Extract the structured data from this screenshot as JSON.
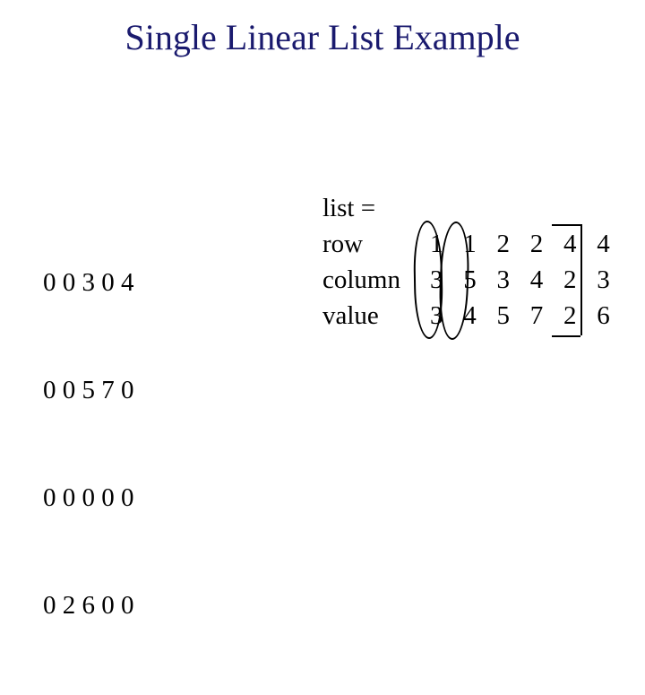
{
  "title": "Single Linear List Example",
  "matrix": {
    "rows": [
      "0 0 3 0 4",
      "0 0 5 7 0",
      "0 0 0 0 0",
      "0 2 6 0 0"
    ]
  },
  "list": {
    "header": "list =",
    "row_label": "row",
    "column_label": "column",
    "value_label": "value",
    "row": [
      "1",
      "1",
      "2",
      "2",
      "4",
      "4"
    ],
    "column": [
      "3",
      "5",
      "3",
      "4",
      "2",
      "3"
    ],
    "value": [
      "3",
      "4",
      "5",
      "7",
      "2",
      "6"
    ]
  }
}
